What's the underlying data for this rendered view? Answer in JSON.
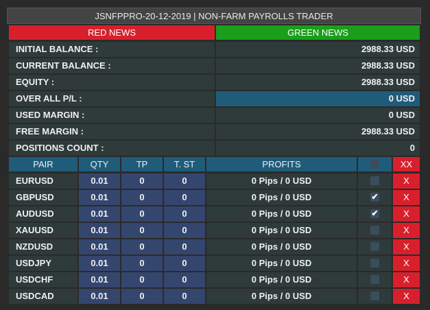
{
  "title": "JSNFPPRO-20-12-2019 | NON-FARM PAYROLLS TRADER",
  "buttons": {
    "red_news": "RED NEWS",
    "green_news": "GREEN NEWS"
  },
  "summary": [
    {
      "label": "INITIAL BALANCE :",
      "value": "2988.33 USD"
    },
    {
      "label": "CURRENT BALANCE :",
      "value": "2988.33 USD"
    },
    {
      "label": "EQUITY :",
      "value": "2988.33 USD"
    },
    {
      "label": "OVER ALL P/L :",
      "value": "0 USD"
    },
    {
      "label": "USED MARGIN :",
      "value": "0 USD"
    },
    {
      "label": "FREE MARGIN :",
      "value": "2988.33 USD"
    },
    {
      "label": "POSITIONS COUNT :",
      "value": "0"
    }
  ],
  "table": {
    "headers": {
      "pair": "PAIR",
      "qty": "QTY",
      "tp": "TP",
      "tst": "T. ST",
      "profits": "PROFITS",
      "close_all": "XX"
    },
    "rows": [
      {
        "pair": "EURUSD",
        "qty": "0.01",
        "tp": "0",
        "tst": "0",
        "profit": "0 Pips / 0 USD",
        "checked": false,
        "close": "X"
      },
      {
        "pair": "GBPUSD",
        "qty": "0.01",
        "tp": "0",
        "tst": "0",
        "profit": "0 Pips / 0 USD",
        "checked": true,
        "close": "X"
      },
      {
        "pair": "AUDUSD",
        "qty": "0.01",
        "tp": "0",
        "tst": "0",
        "profit": "0 Pips / 0 USD",
        "checked": true,
        "close": "X"
      },
      {
        "pair": "XAUUSD",
        "qty": "0.01",
        "tp": "0",
        "tst": "0",
        "profit": "0 Pips / 0 USD",
        "checked": false,
        "close": "X"
      },
      {
        "pair": "NZDUSD",
        "qty": "0.01",
        "tp": "0",
        "tst": "0",
        "profit": "0 Pips / 0 USD",
        "checked": false,
        "close": "X"
      },
      {
        "pair": "USDJPY",
        "qty": "0.01",
        "tp": "0",
        "tst": "0",
        "profit": "0 Pips / 0 USD",
        "checked": false,
        "close": "X"
      },
      {
        "pair": "USDCHF",
        "qty": "0.01",
        "tp": "0",
        "tst": "0",
        "profit": "0 Pips / 0 USD",
        "checked": false,
        "close": "X"
      },
      {
        "pair": "USDCAD",
        "qty": "0.01",
        "tp": "0",
        "tst": "0",
        "profit": "0 Pips / 0 USD",
        "checked": false,
        "close": "X"
      }
    ]
  },
  "colors": {
    "red": "#d8202c",
    "green": "#1b9e1b",
    "header_blue": "#1f5c7a",
    "cell_blue": "#35466e"
  }
}
